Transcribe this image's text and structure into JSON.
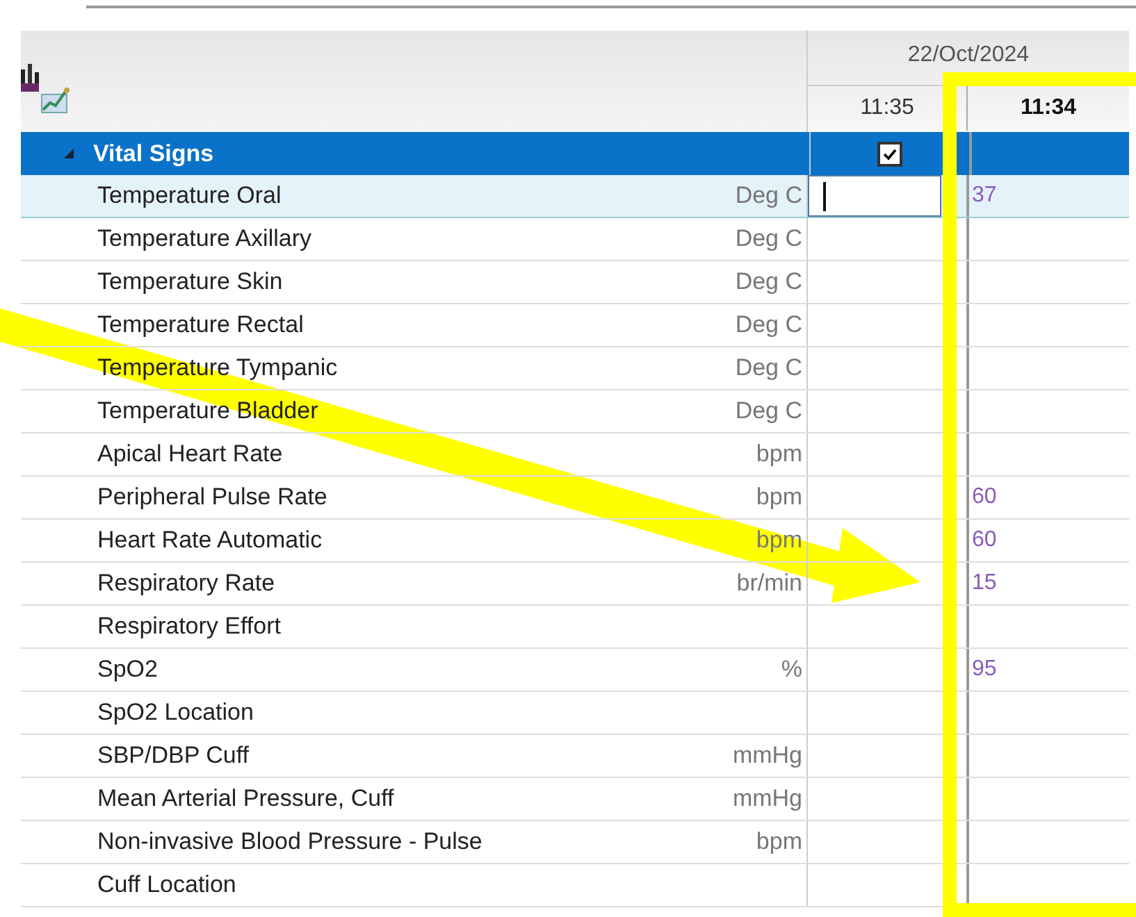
{
  "table": {
    "date": "22/Oct/2024",
    "columns": [
      {
        "time": "11:35"
      },
      {
        "time": "11:34"
      }
    ],
    "section": {
      "label": "Vital Signs",
      "expanded": true,
      "selected": true,
      "checked": true
    },
    "rows": [
      {
        "name": "Temperature Oral",
        "unit": "Deg C",
        "editing": true,
        "value": "37",
        "selected": true
      },
      {
        "name": "Temperature Axillary",
        "unit": "Deg C",
        "selected": false
      },
      {
        "name": "Temperature Skin",
        "unit": "Deg C",
        "selected": false
      },
      {
        "name": "Temperature Rectal",
        "unit": "Deg C",
        "selected": false
      },
      {
        "name": "Temperature Tympanic",
        "unit": "Deg C",
        "selected": false
      },
      {
        "name": "Temperature Bladder",
        "unit": "Deg C",
        "selected": false
      },
      {
        "name": "Apical Heart Rate",
        "unit": "bpm",
        "selected": false
      },
      {
        "name": "Peripheral Pulse Rate",
        "unit": "bpm",
        "value": "60",
        "selected": false
      },
      {
        "name": "Heart Rate Automatic",
        "unit": "bpm",
        "value": "60",
        "selected": false
      },
      {
        "name": "Respiratory Rate",
        "unit": "br/min",
        "value": "15",
        "selected": false
      },
      {
        "name": "Respiratory Effort",
        "selected": false
      },
      {
        "name": "SpO2",
        "unit": "%",
        "value": "95",
        "selected": false
      },
      {
        "name": "SpO2 Location",
        "selected": false
      },
      {
        "name": "SBP/DBP Cuff",
        "unit": "mmHg",
        "selected": false
      },
      {
        "name": "Mean Arterial Pressure, Cuff",
        "unit": "mmHg",
        "selected": false
      },
      {
        "name": "Non-invasive Blood Pressure - Pulse",
        "unit": "bpm",
        "selected": false
      },
      {
        "name": "Cuff Location",
        "selected": false
      }
    ]
  }
}
